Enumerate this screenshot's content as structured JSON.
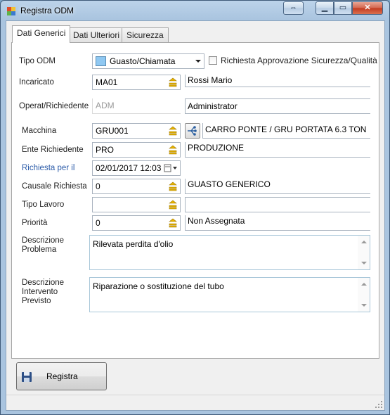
{
  "window": {
    "title": "Registra ODM",
    "help_glyph": "⇔",
    "min_glyph": "▁",
    "max_glyph": "▭",
    "close_glyph": "✕"
  },
  "tabs": [
    {
      "label": "Dati Generici",
      "active": true
    },
    {
      "label": "Dati Ulteriori",
      "active": false
    },
    {
      "label": "Sicurezza",
      "active": false
    }
  ],
  "form": {
    "tipo_odm": {
      "label": "Tipo ODM",
      "value": "Guasto/Chiamata",
      "swatch_color": "#8fc8f2"
    },
    "richiesta_approvazione": {
      "label": "Richiesta Approvazione Sicurezza/Qualità",
      "checked": false
    },
    "incaricato": {
      "label": "Incaricato",
      "code": "MA01",
      "description": "Rossi Mario"
    },
    "operat_richiedente": {
      "label": "Operat/Richiedente",
      "code": "ADM",
      "description": "Administrator"
    },
    "macchina": {
      "label": "Macchina",
      "code": "GRU001",
      "description": "CARRO PONTE / GRU PORTATA 6.3 TON"
    },
    "ente_richiedente": {
      "label": "Ente Richiedente",
      "code": "PRO",
      "description": "PRODUZIONE"
    },
    "richiesta_per_il": {
      "label": "Richiesta per il",
      "value": "02/01/2017 12:03"
    },
    "causale_richiesta": {
      "label": "Causale Richiesta",
      "code": "0",
      "description": "GUASTO GENERICO"
    },
    "tipo_lavoro": {
      "label": "Tipo Lavoro",
      "code": "",
      "description": ""
    },
    "priorita": {
      "label": "Priorità",
      "code": "0",
      "description": "Non Assegnata"
    },
    "descrizione_problema": {
      "label_line1": "Descrizione",
      "label_line2": "Problema",
      "value": "Rilevata perdita d'olio"
    },
    "descrizione_intervento": {
      "label_line1": "Descrizione",
      "label_line2": "Intervento",
      "label_line3": "Previsto",
      "value": "Riparazione o sostituzione del tubo"
    }
  },
  "actions": {
    "save_label": "Registra"
  },
  "colors": {
    "link_label": "#2a5aa8",
    "lookup_icon": "#e8b400"
  }
}
